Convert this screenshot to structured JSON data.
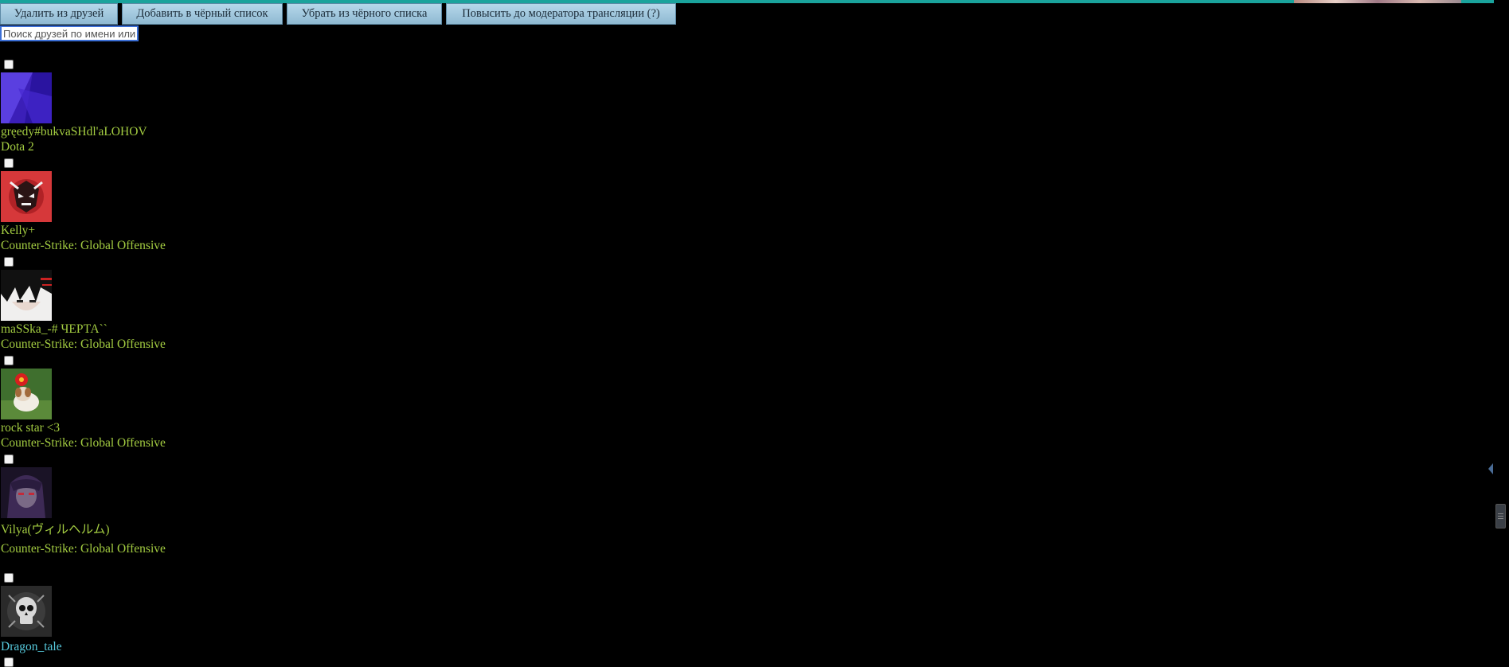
{
  "toolbar": {
    "remove_label": "Удалить из друзей",
    "block_label": "Добавить в чёрный список",
    "unblock_label": "Убрать из чёрного списка",
    "promote_label": "Повысить до модератора трансляции (?)"
  },
  "search": {
    "placeholder": "Поиск друзей по имени или"
  },
  "friends": [
    {
      "name": "gręedy#bukvaSHdl'aLOHOV",
      "game": "Dota 2",
      "avatar": "purple-abstract-avatar"
    },
    {
      "name": "Kelly+",
      "game": "Counter-Strike: Global Offensive",
      "avatar": "samurai-mask-avatar"
    },
    {
      "name": "maSSka_-# ЧЕРТА``",
      "game": "Counter-Strike: Global Offensive",
      "avatar": "anime-character-avatar"
    },
    {
      "name": "rock star <3",
      "game": "Counter-Strike: Global Offensive",
      "avatar": "dog-with-flower-avatar"
    },
    {
      "name": "Vilya(ヴィルヘルム)",
      "game": "Counter-Strike: Global Offensive",
      "avatar": "dark-anime-girl-avatar"
    },
    {
      "name": "Dragon_tale",
      "avatar": "skull-avatar"
    }
  ],
  "colors": {
    "in_game": "#a3cc41",
    "online": "#57cbde",
    "button": "#a7cbe0",
    "accent_top": "#1aa39c"
  }
}
